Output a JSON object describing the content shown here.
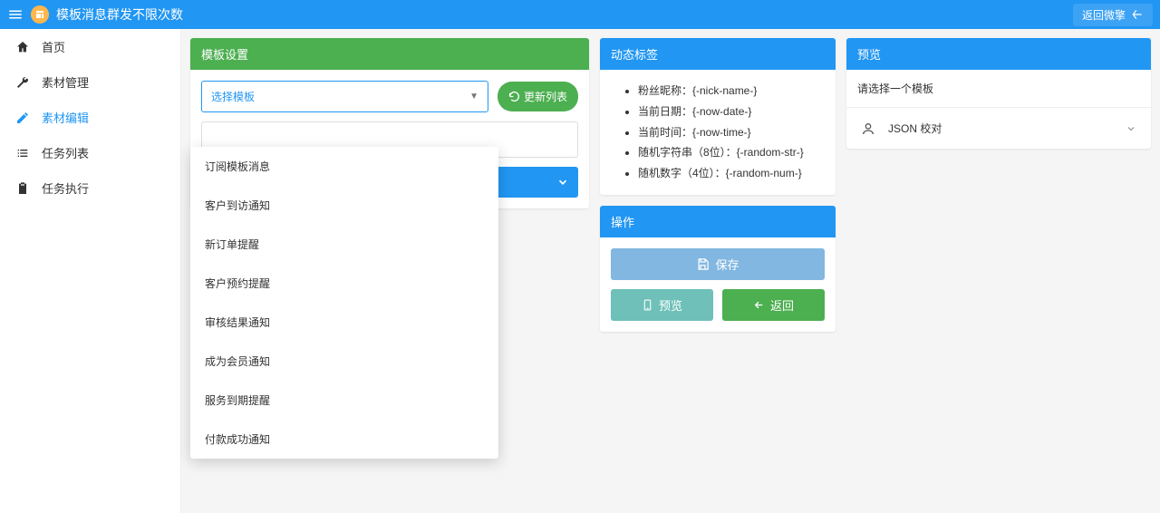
{
  "topbar": {
    "title": "模板消息群发不限次数",
    "back_label": "返回微擎"
  },
  "sidebar": {
    "items": [
      {
        "label": "首页",
        "icon": "home",
        "active": false
      },
      {
        "label": "素材管理",
        "icon": "wrench",
        "active": false
      },
      {
        "label": "素材编辑",
        "icon": "pencil",
        "active": true
      },
      {
        "label": "任务列表",
        "icon": "list",
        "active": false
      },
      {
        "label": "任务执行",
        "icon": "clipboard",
        "active": false
      }
    ]
  },
  "template_panel": {
    "title": "模板设置",
    "select_placeholder": "选择模板",
    "refresh_label": "更新列表",
    "options": [
      "订阅模板消息",
      "客户到访通知",
      "新订单提醒",
      "客户预约提醒",
      "审核结果通知",
      "成为会员通知",
      "服务到期提醒",
      "付款成功通知"
    ]
  },
  "tags_panel": {
    "title": "动态标签",
    "items": [
      "粉丝昵称：{-nick-name-}",
      "当前日期：{-now-date-}",
      "当前时间：{-now-time-}",
      "随机字符串（8位）：{-random-str-}",
      "随机数字（4位）：{-random-num-}"
    ]
  },
  "actions_panel": {
    "title": "操作",
    "save_label": "保存",
    "preview_label": "预览",
    "back_label": "返回"
  },
  "preview_panel": {
    "title": "预览",
    "placeholder": "请选择一个模板",
    "json_label": "JSON 校对"
  }
}
